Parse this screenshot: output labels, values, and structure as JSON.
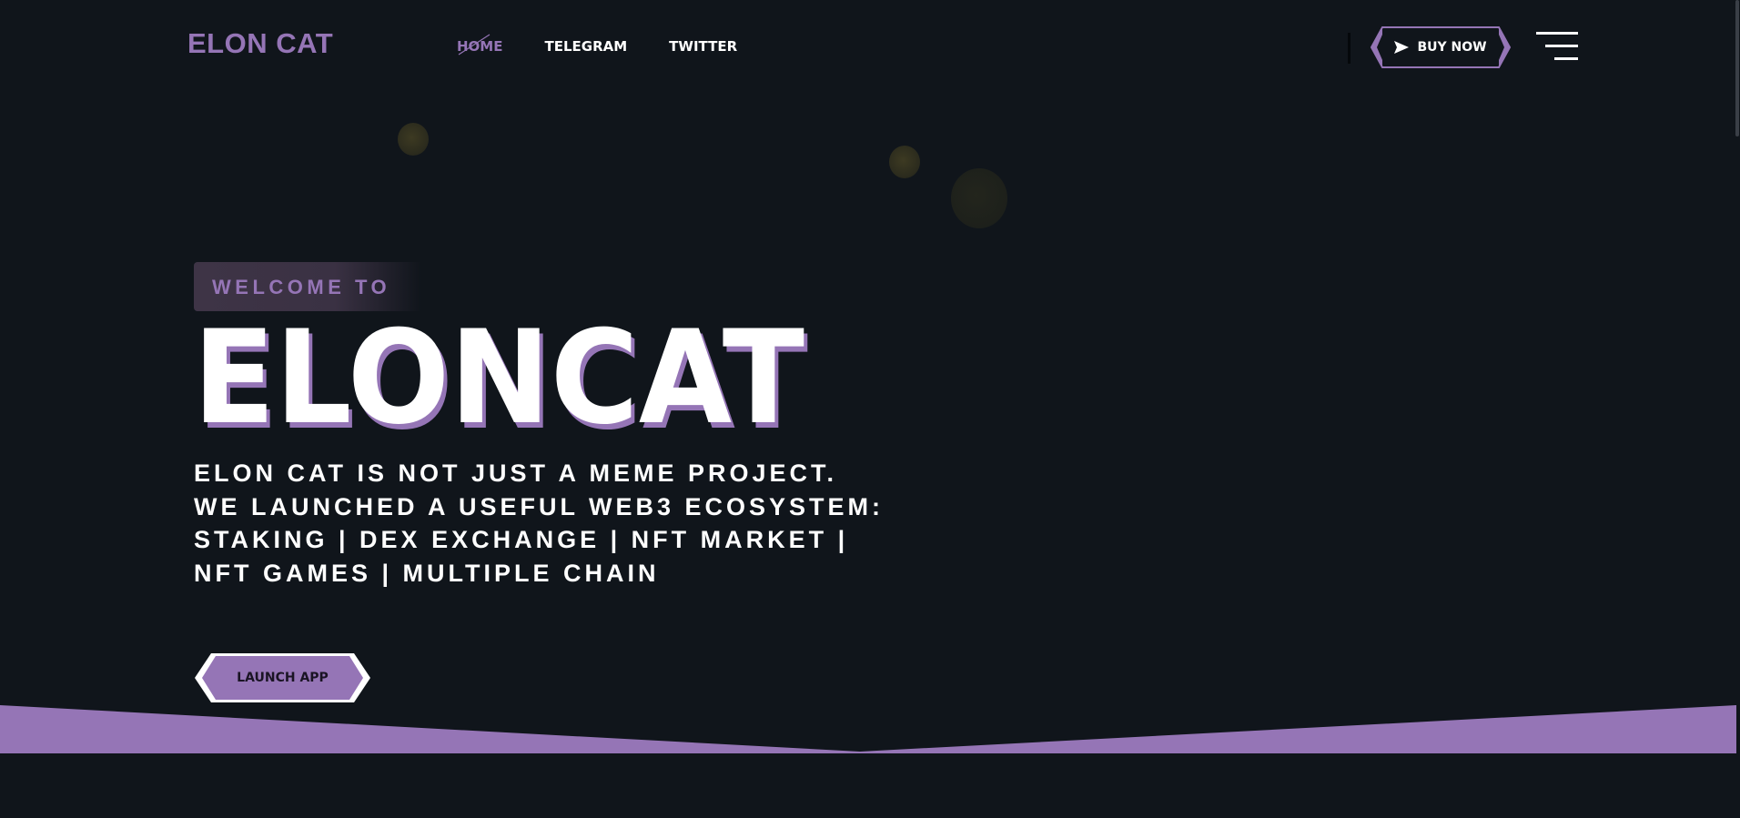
{
  "header": {
    "logo": "ELON CAT",
    "nav": [
      {
        "label": "HOME",
        "active": true
      },
      {
        "label": "TELEGRAM",
        "active": false
      },
      {
        "label": "TWITTER",
        "active": false
      }
    ],
    "buy_button": {
      "label": "BUY NOW",
      "icon": "send-icon"
    },
    "menu_icon": "hamburger-menu-icon"
  },
  "hero": {
    "eyebrow": "WELCOME TO",
    "title": "ELONCAT",
    "description": "ELON CAT IS NOT JUST A MEME PROJECT. WE LAUNCHED A USEFUL WEB3 ECOSYSTEM: STAKING | DEX EXCHANGE | NFT MARKET | NFT GAMES | MULTIPLE CHAIN",
    "cta": "LAUNCH APP"
  },
  "colors": {
    "background": "#10151b",
    "accent": "#9575b6",
    "text": "#ffffff",
    "coin": "#3d3a22"
  }
}
